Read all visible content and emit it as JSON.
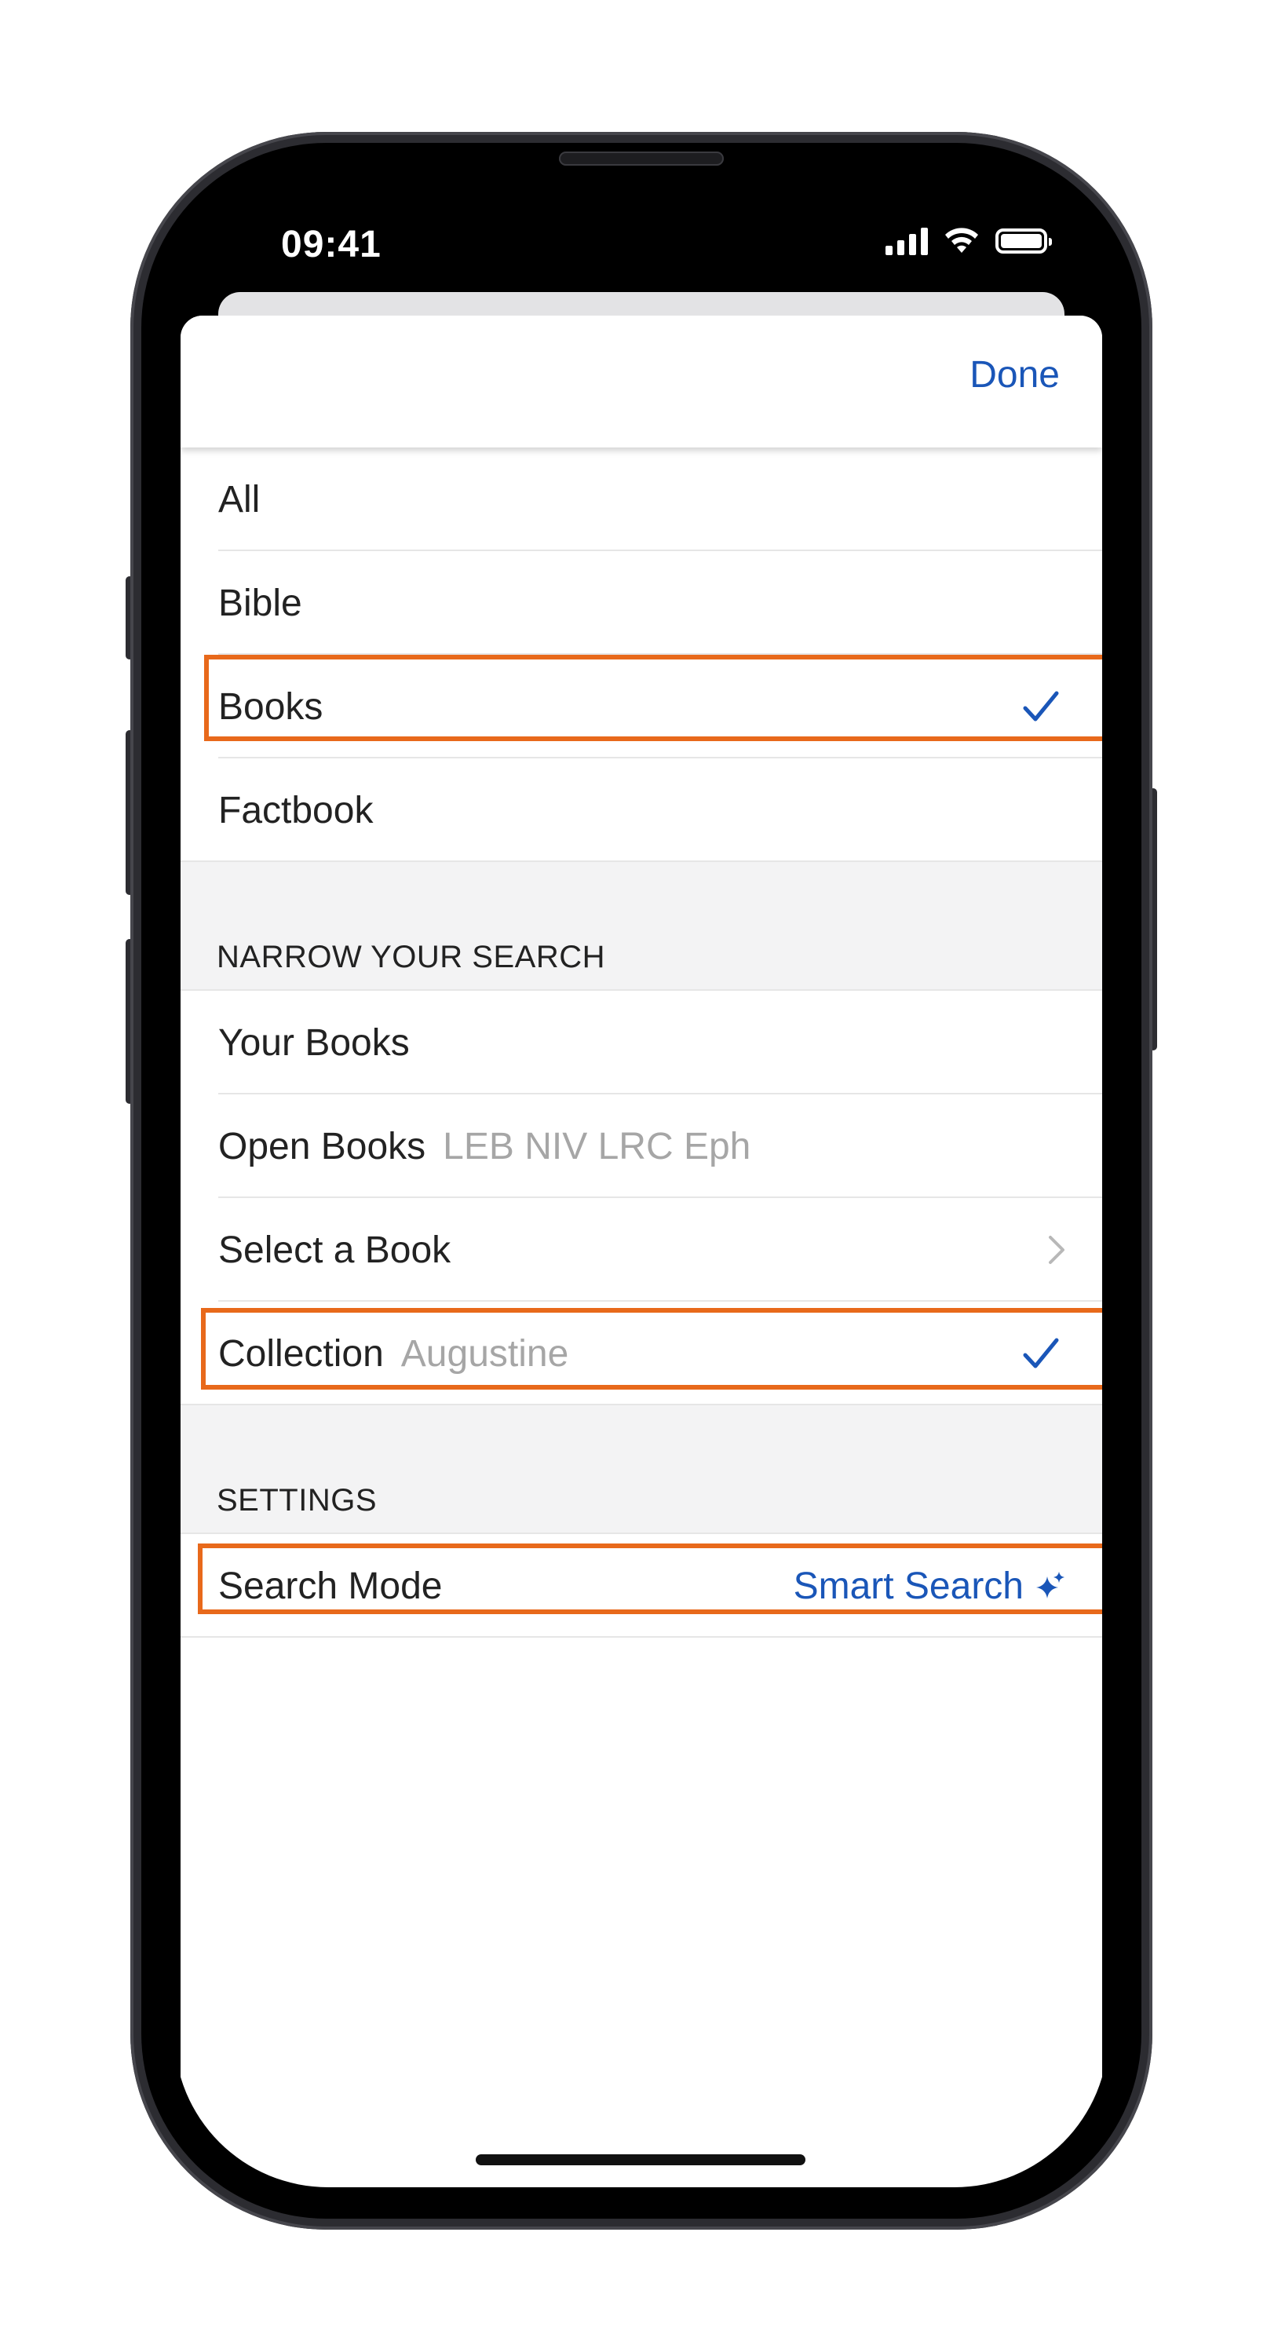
{
  "status_bar": {
    "time": "09:41",
    "icons": [
      "cellular-signal-icon",
      "wifi-icon",
      "battery-icon"
    ]
  },
  "header": {
    "done_label": "Done"
  },
  "scope_options": [
    {
      "label": "All",
      "selected": false
    },
    {
      "label": "Bible",
      "selected": false
    },
    {
      "label": "Books",
      "selected": true
    },
    {
      "label": "Factbook",
      "selected": false
    }
  ],
  "narrow_section": {
    "title": "NARROW YOUR SEARCH",
    "your_books": {
      "label": "Your Books",
      "selected": false
    },
    "open_books": {
      "label": "Open Books",
      "subtext": "LEB NIV LRC Eph",
      "selected": false
    },
    "select_book": {
      "label": "Select a Book"
    },
    "collection": {
      "label": "Collection",
      "subtext": "Augustine",
      "selected": true
    }
  },
  "settings_section": {
    "title": "SETTINGS",
    "search_mode": {
      "label": "Search Mode",
      "value": "Smart Search",
      "icon": "sparkle-icon"
    }
  },
  "colors": {
    "accent": "#1a56b8",
    "highlight": "#e8691b",
    "section_bg": "#f3f3f4",
    "muted_text": "#a6a6a6"
  }
}
